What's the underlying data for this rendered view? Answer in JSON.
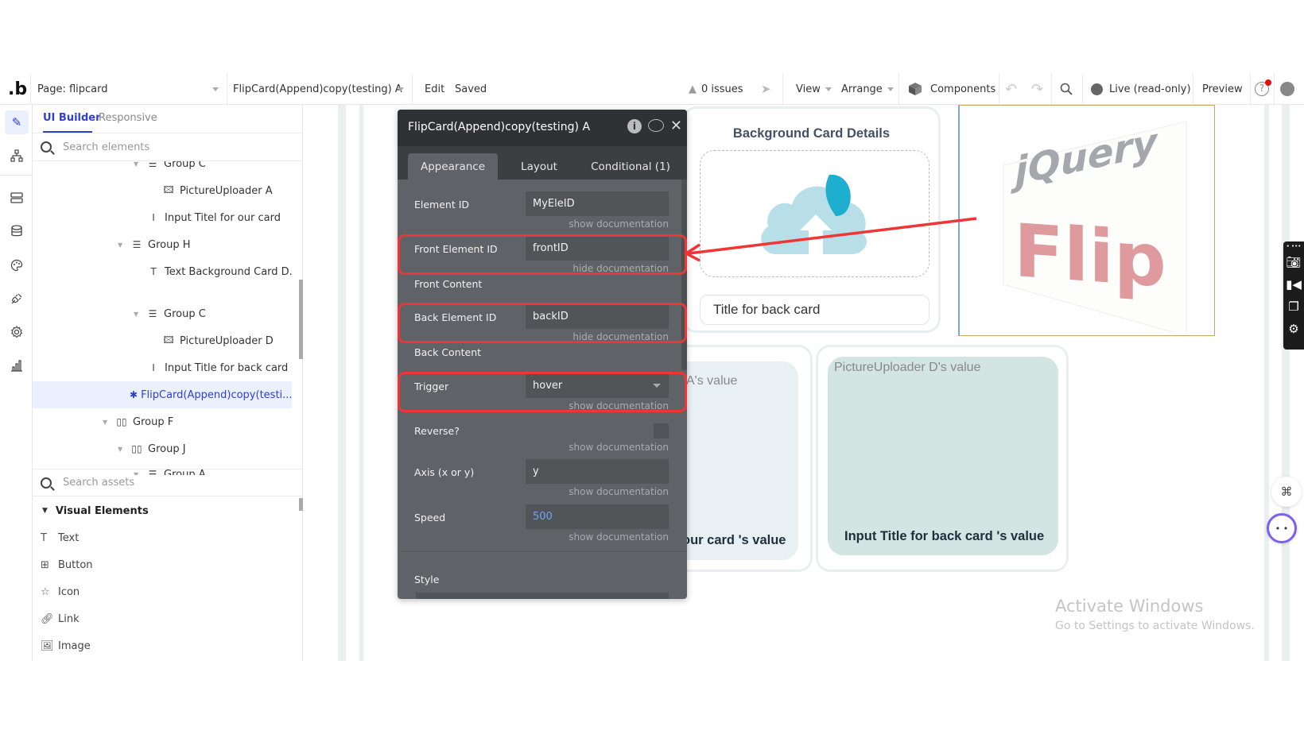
{
  "topbar": {
    "logo": ".b",
    "page_label": "Page: flipcard",
    "element_selector": "FlipCard(Append)copy(testing) A",
    "edit": "Edit",
    "saved": "Saved",
    "issues": "0 issues",
    "view": "View",
    "arrange": "Arrange",
    "components": "Components",
    "live": "Live (read-only)",
    "preview": "Preview"
  },
  "rail": {
    "icons": [
      "design-icon",
      "workflow-icon",
      "data-icon",
      "database-icon",
      "styles-icon",
      "plugins-icon",
      "settings-icon",
      "logs-icon"
    ]
  },
  "left_panel": {
    "tabs": {
      "ui_builder": "UI Builder",
      "responsive": "Responsive"
    },
    "search_elements_placeholder": "Search elements",
    "tree": [
      {
        "label": "Group C",
        "type": "group",
        "expanded": true
      },
      {
        "label": "PictureUploader A",
        "type": "picture-uploader"
      },
      {
        "label": "Input Titel for our card",
        "type": "input"
      },
      {
        "label": "Group H",
        "type": "group",
        "expanded": true
      },
      {
        "label": "Text Background Card D...",
        "type": "text"
      },
      {
        "label": "Group C",
        "type": "group",
        "expanded": true
      },
      {
        "label": "PictureUploader D",
        "type": "picture-uploader"
      },
      {
        "label": "Input Title for back card",
        "type": "input"
      },
      {
        "label": "FlipCard(Append)copy(testi...",
        "type": "plugin",
        "selected": true
      },
      {
        "label": "Group F",
        "type": "row-group",
        "expanded": true
      },
      {
        "label": "Group J",
        "type": "row-group",
        "expanded": true
      },
      {
        "label": "Group A",
        "type": "group",
        "expanded": true
      }
    ],
    "search_assets_placeholder": "Search assets",
    "assets_section": "Visual Elements",
    "assets": [
      "Text",
      "Button",
      "Icon",
      "Link",
      "Image"
    ]
  },
  "editor": {
    "title": "FlipCard(Append)copy(testing) A",
    "tabs": [
      "Appearance",
      "Layout",
      "Conditional (1)"
    ],
    "active_tab": "Appearance",
    "properties": {
      "element_id": {
        "label": "Element ID",
        "value": "MyEleID",
        "doc": "show documentation"
      },
      "front_element_id": {
        "label": "Front Element ID",
        "value": "frontID",
        "doc": "hide documentation"
      },
      "front_content": {
        "label": "Front Content"
      },
      "back_element_id": {
        "label": "Back Element ID",
        "value": "backID",
        "doc": "hide documentation"
      },
      "back_content": {
        "label": "Back Content"
      },
      "trigger": {
        "label": "Trigger",
        "value": "hover",
        "doc": "show documentation"
      },
      "reverse": {
        "label": "Reverse?",
        "checked": false,
        "doc": "show documentation"
      },
      "axis": {
        "label": "Axis (x or y)",
        "value": "y",
        "doc": "show documentation"
      },
      "speed": {
        "label": "Speed",
        "value": "500",
        "doc": "show documentation"
      },
      "style": {
        "label": "Style"
      }
    },
    "highlight_color": "#ef3535"
  },
  "canvas": {
    "back_card": {
      "title": "Background Card Details",
      "input_value": "Title for back card"
    },
    "flip_image": {
      "line1": "jQuery",
      "line2": "Flip"
    },
    "value_cards": {
      "a_value": "A's value",
      "a_title": "our card 's value",
      "d_value": "PictureUploader D's value",
      "d_title": "Input Title for back card 's value"
    },
    "watermark": {
      "title": "Activate Windows",
      "subtitle": "Go to Settings to activate Windows."
    }
  },
  "colors": {
    "accent": "#2f3fd0",
    "editor_bg": "#5f6367",
    "editor_header": "#2e3235",
    "annotation_red": "#ef3535",
    "cloud_light": "#b8dfe8",
    "cloud_dark": "#1eaed0",
    "flip_red": "#de9a9c",
    "jquery_gray": "#a4a8ad"
  }
}
